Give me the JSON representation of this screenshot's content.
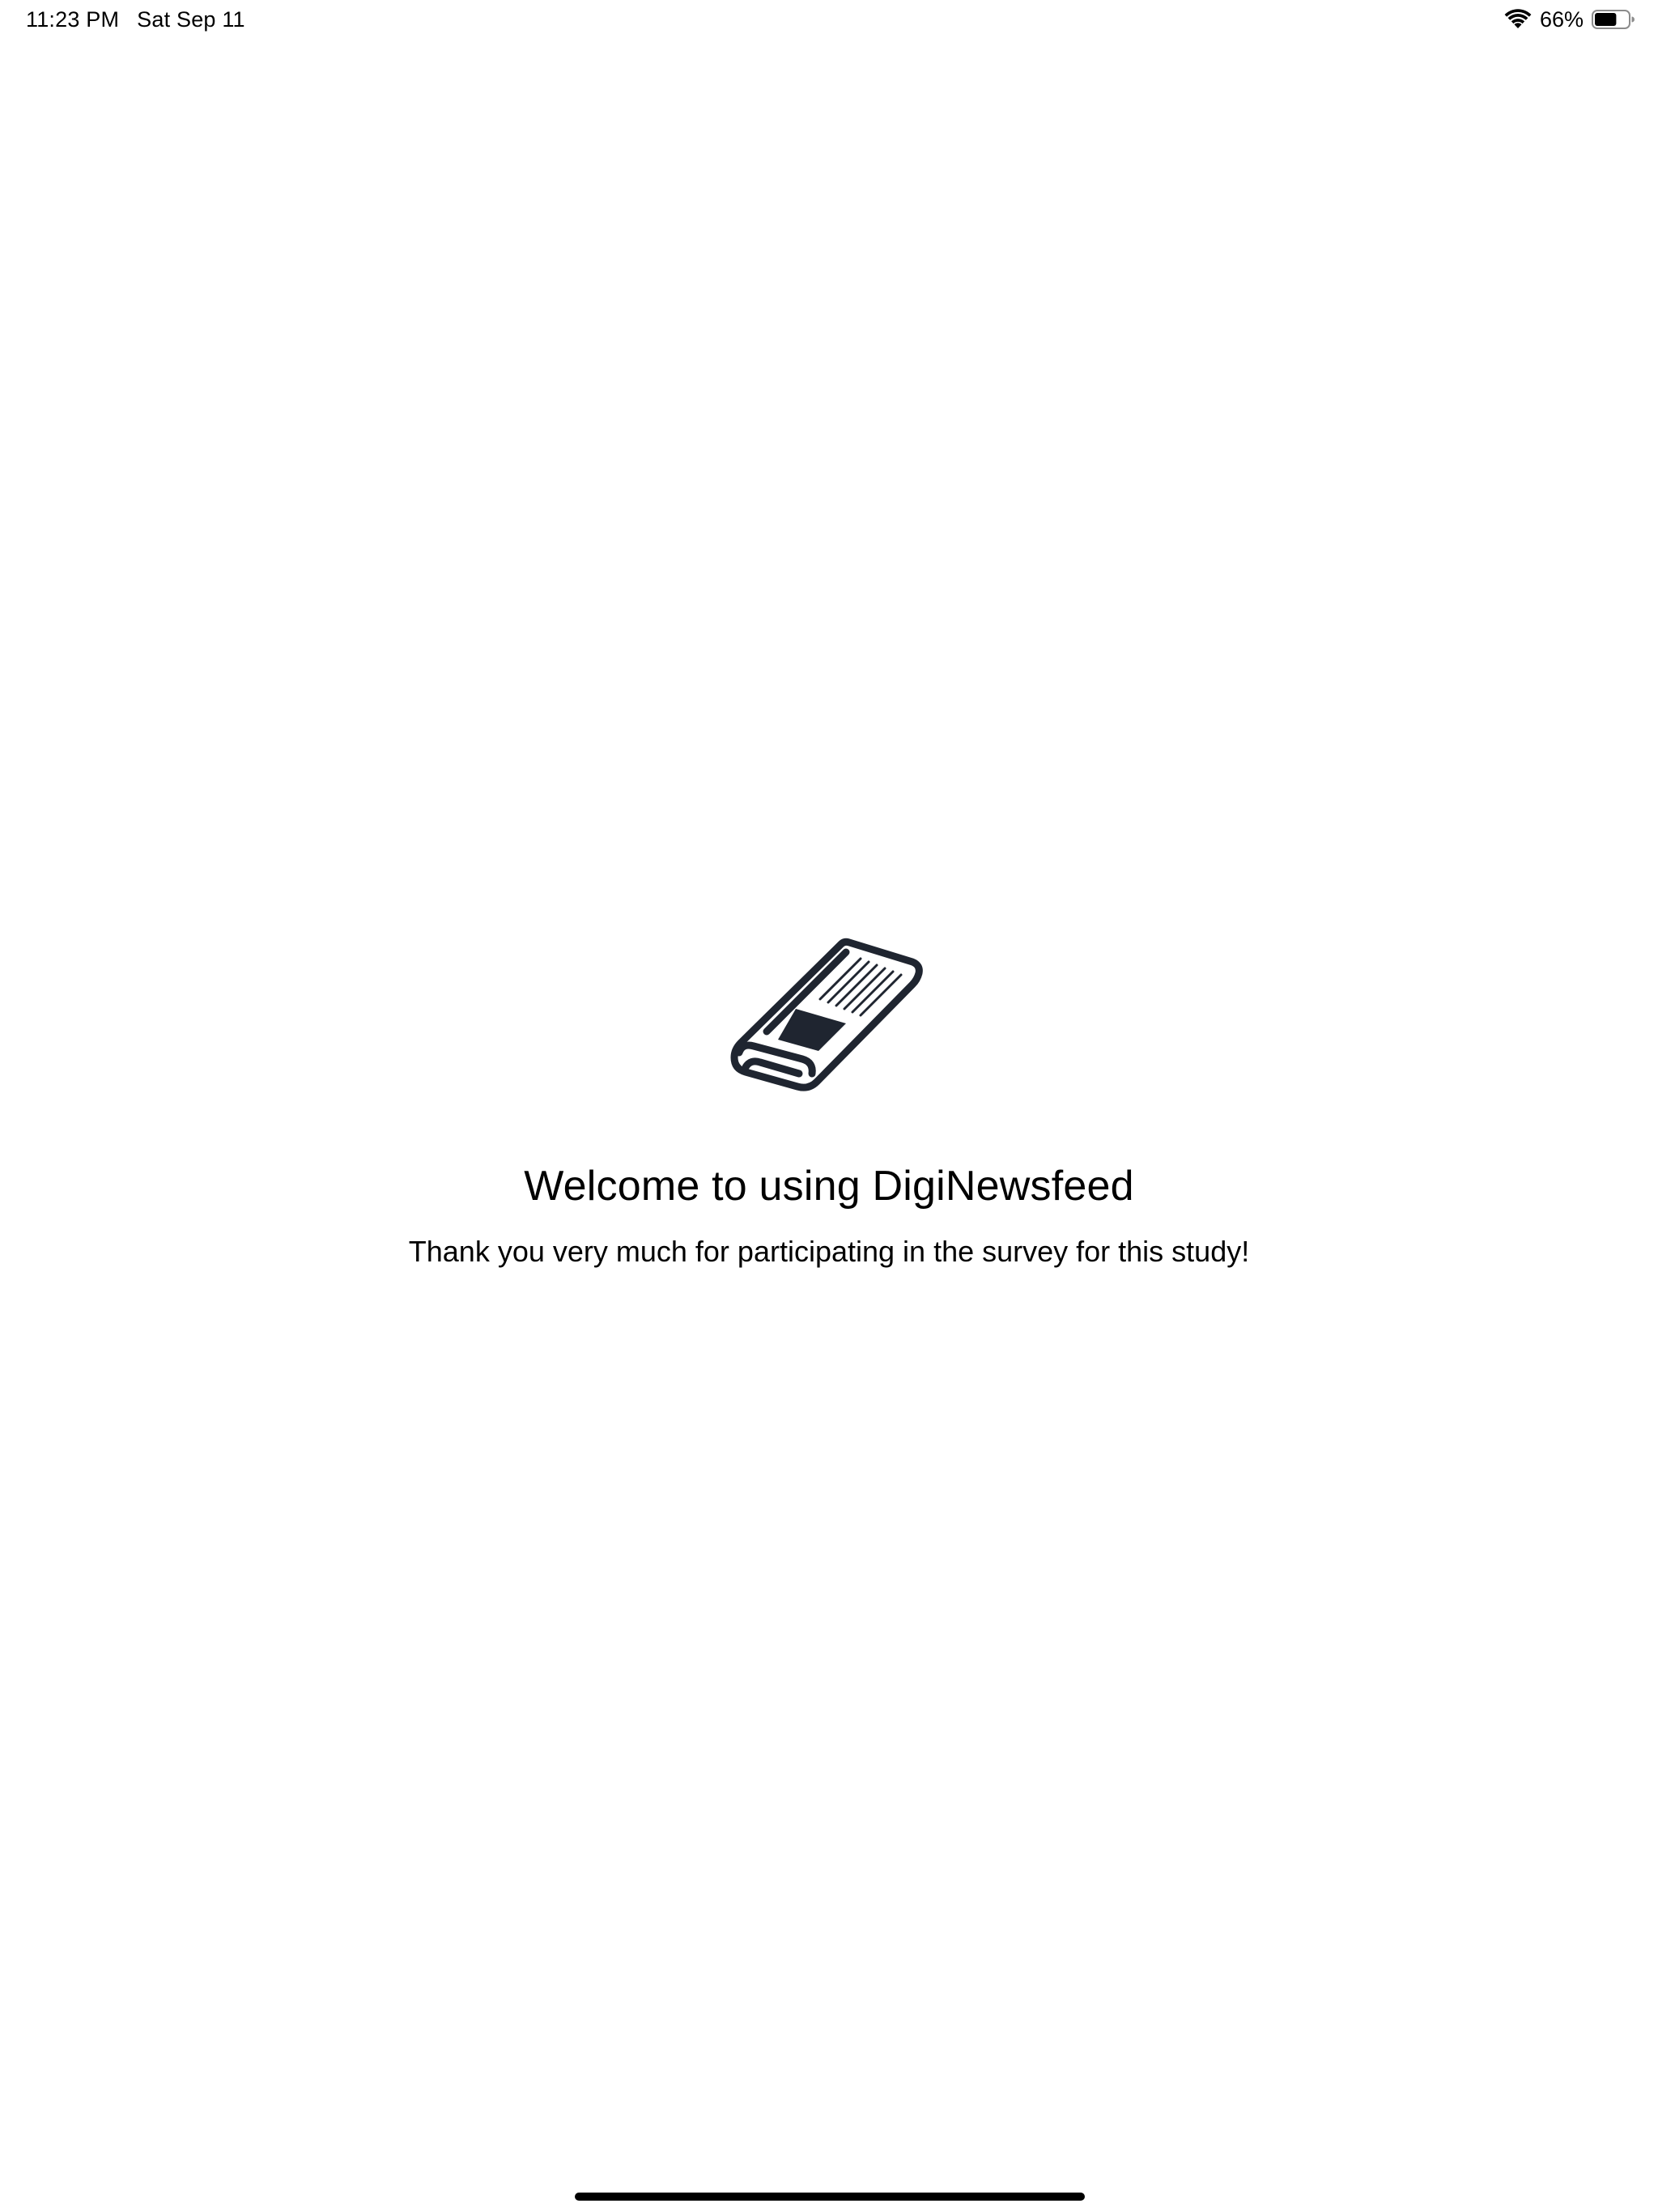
{
  "status_bar": {
    "time": "11:23 PM",
    "date": "Sat Sep 11",
    "battery_percent": "66%",
    "battery_level": 0.66
  },
  "welcome": {
    "icon": "newspaper-icon",
    "title": "Welcome to using DigiNewsfeed",
    "subtitle": "Thank you very much for participating in the survey for this study!"
  },
  "colors": {
    "icon_stroke": "#1f2530",
    "text": "#000000",
    "background": "#ffffff"
  }
}
